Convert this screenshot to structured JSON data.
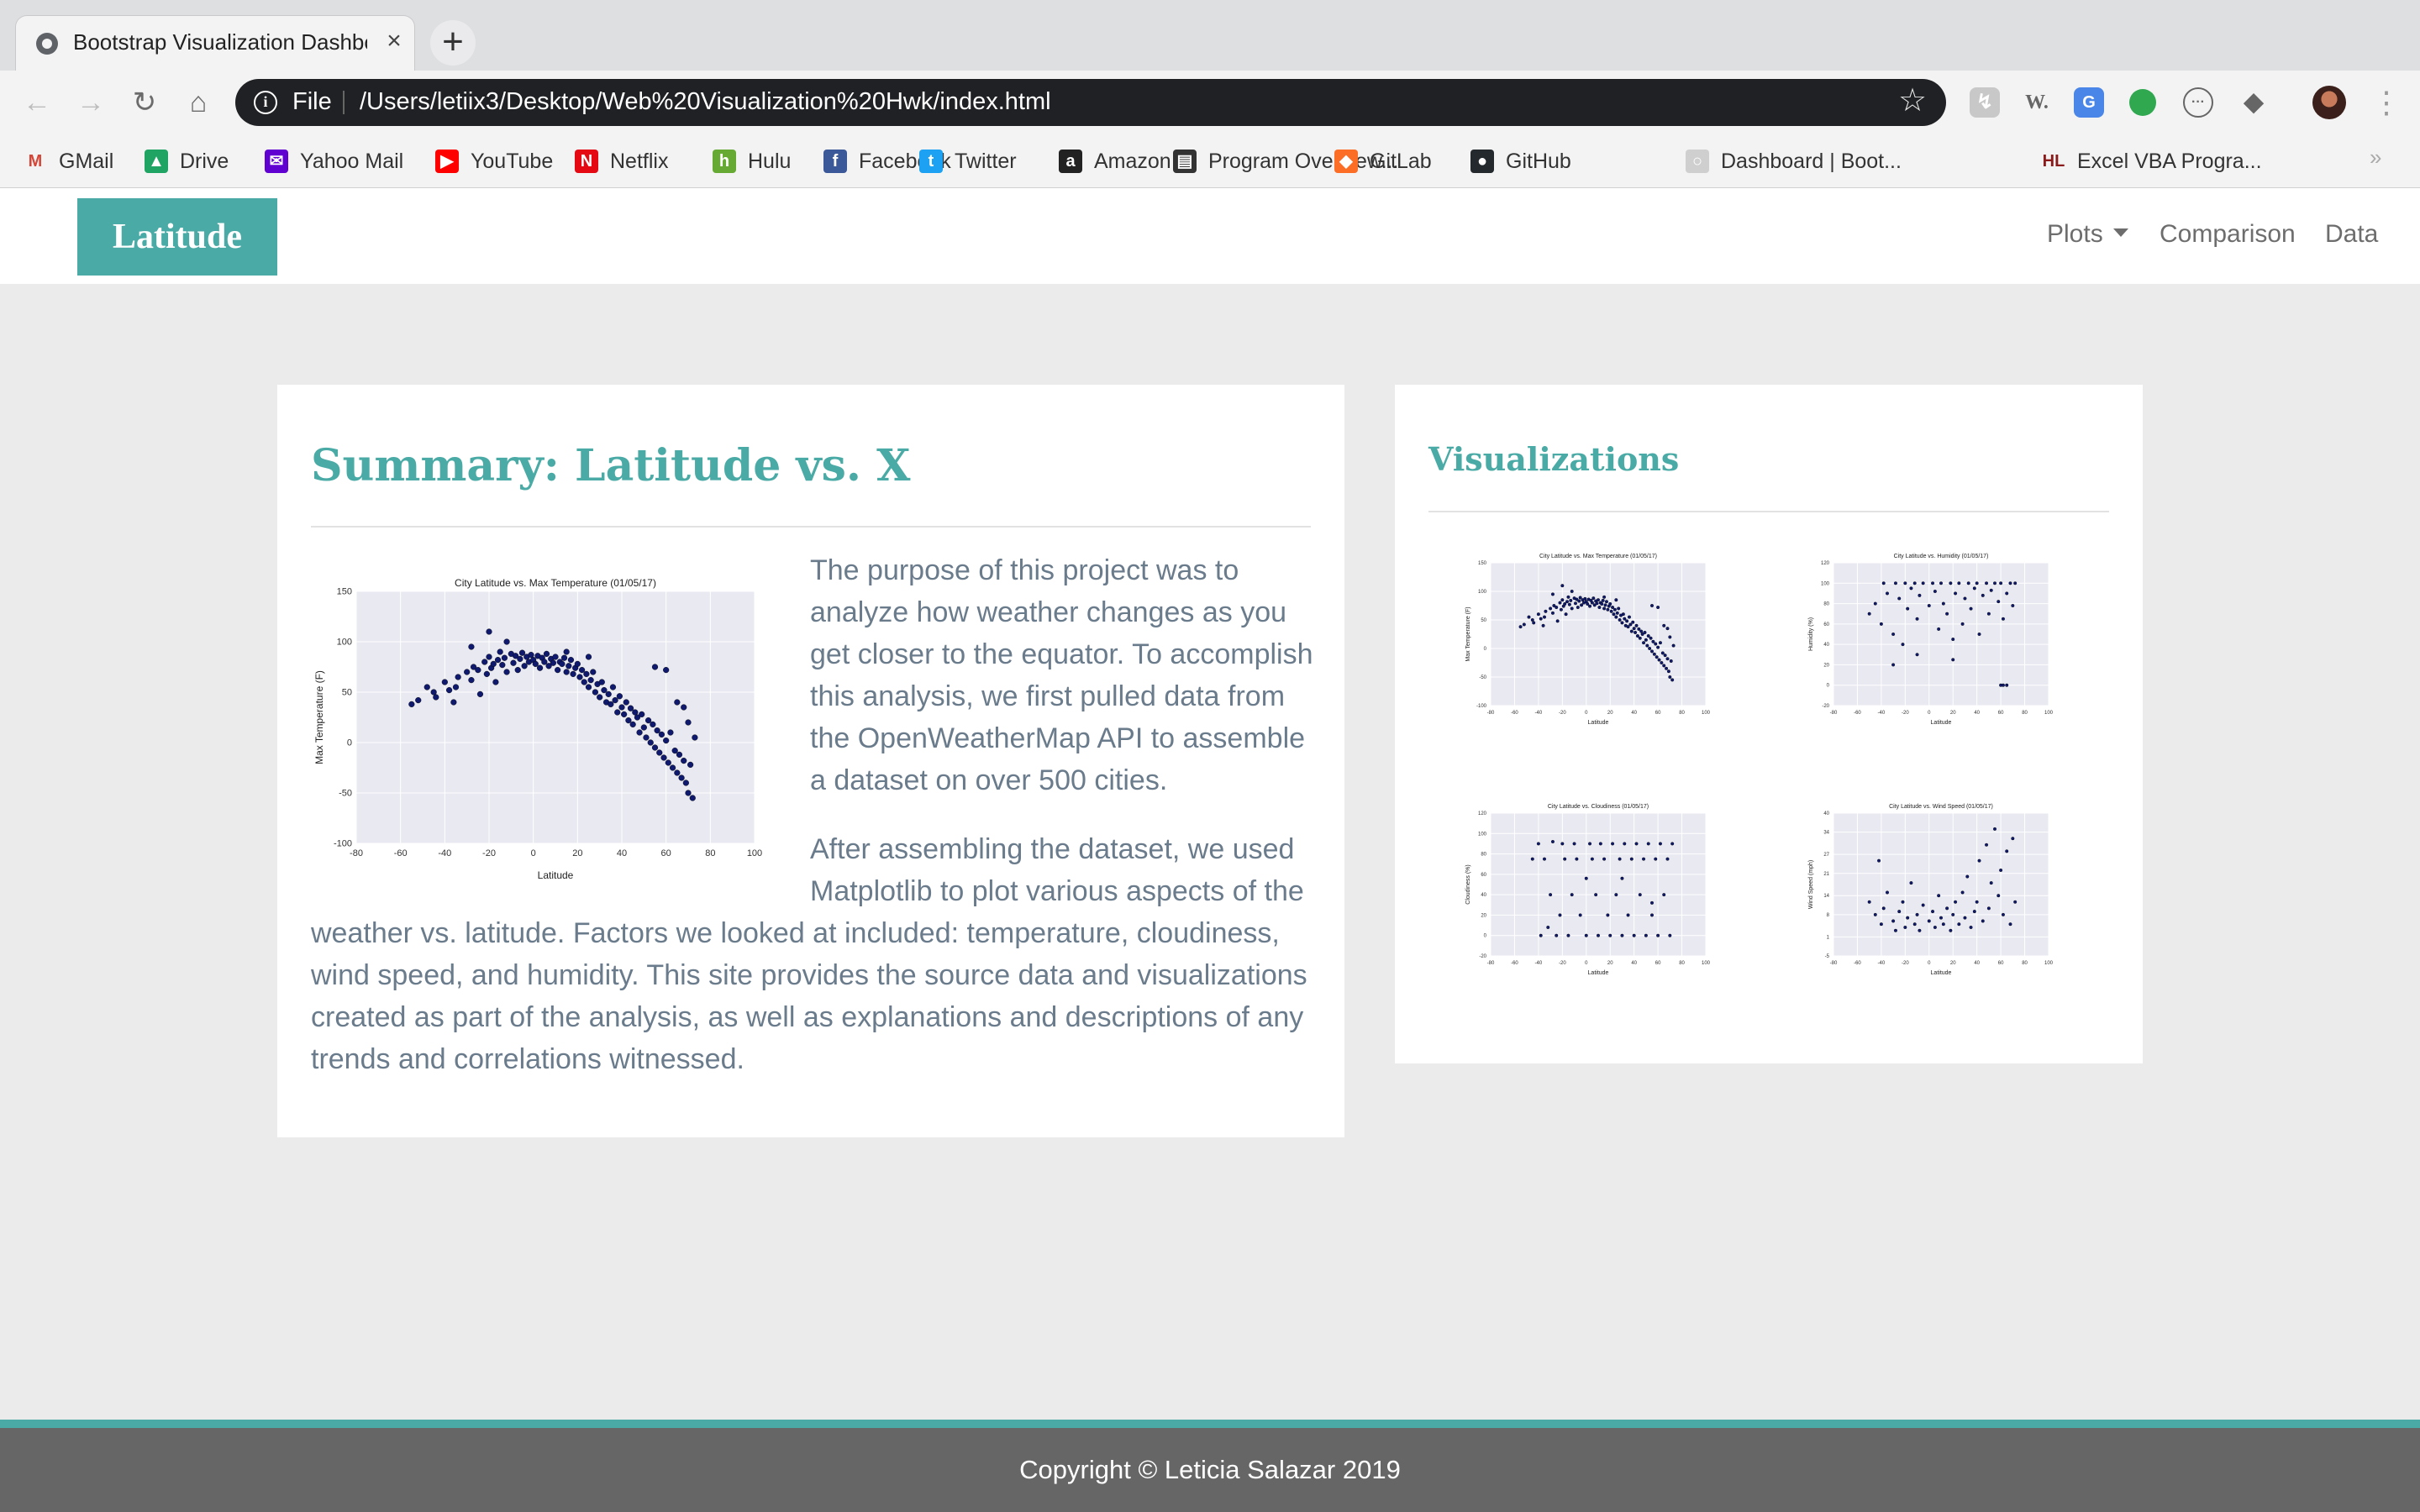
{
  "browser": {
    "tab": {
      "title": "Bootstrap Visualization Dashbo",
      "close_glyph": "×",
      "favicon": "globe-icon"
    },
    "new_tab_glyph": "+",
    "nav": {
      "back": "←",
      "forward": "→",
      "reload": "↻",
      "home": "⌂"
    },
    "address": {
      "scheme": "File",
      "url": "/Users/letiix3/Desktop/Web%20Visualization%20Hwk/index.html",
      "star": "☆"
    },
    "menu_glyph": "⋮",
    "bookmarks": [
      {
        "label": "GMail",
        "icon": "gmail-icon",
        "glyph": "M",
        "color": "#d44638"
      },
      {
        "label": "Drive",
        "icon": "drive-icon",
        "glyph": "▲",
        "color": "#1fa463"
      },
      {
        "label": "Yahoo Mail",
        "icon": "yahoo-mail-icon",
        "glyph": "✉",
        "color": "#6001d2"
      },
      {
        "label": "YouTube",
        "icon": "youtube-icon",
        "glyph": "▶",
        "color": "#ff0000"
      },
      {
        "label": "Netflix",
        "icon": "netflix-icon",
        "glyph": "N",
        "color": "#e50914"
      },
      {
        "label": "Hulu",
        "icon": "hulu-icon",
        "glyph": "h",
        "color": "#66aa33"
      },
      {
        "label": "Facebook",
        "icon": "facebook-icon",
        "glyph": "f",
        "color": "#3b5998"
      },
      {
        "label": "Twitter",
        "icon": "twitter-icon",
        "glyph": "t",
        "color": "#1da1f2"
      },
      {
        "label": "Amazon",
        "icon": "amazon-icon",
        "glyph": "a",
        "color": "#222222"
      },
      {
        "label": "Program Overview...",
        "icon": "book-icon",
        "glyph": "▤",
        "color": "#333333"
      },
      {
        "label": "GitLab",
        "icon": "gitlab-icon",
        "glyph": "◆",
        "color": "#fc6d26"
      },
      {
        "label": "GitHub",
        "icon": "github-icon",
        "glyph": "●",
        "color": "#24292e"
      },
      {
        "label": "Dashboard | Boot...",
        "icon": "globe-icon",
        "glyph": "○",
        "color": "#cfcfcf"
      },
      {
        "label": "Excel VBA Progra...",
        "icon": "excel-vba-icon",
        "glyph": "HL",
        "color": "#8b1a1a"
      }
    ],
    "bookmarks_overflow": "»"
  },
  "page": {
    "brand": "Latitude",
    "nav": {
      "plots": "Plots",
      "comparison": "Comparison",
      "data": "Data"
    },
    "summary": {
      "title": "Summary: Latitude vs. X",
      "paragraph1": "The purpose of this project was to analyze how weather changes as you get closer to the equator. To accomplish this analysis, we first pulled data from the OpenWeatherMap API to assemble a dataset on over 500 cities.",
      "paragraph2_line1": "After assembling the dataset, we used",
      "paragraph2_line2": "Matplotlib to plot various aspects of the",
      "paragraph2_rest": "weather vs. latitude. Factors we looked at included: temperature, cloudiness, wind speed, and humidity. This site provides the source data and visualizations created as part of the analysis, as well as explanations and descriptions of any trends and correlations witnessed."
    },
    "visualizations_title": "Visualizations",
    "footer": "Copyright © Leticia Salazar 2019",
    "accent_color": "#4aaaa5",
    "marker_color": "#0f1a6e"
  },
  "chart_data": [
    {
      "type": "scatter",
      "id": "temperature",
      "title": "City Latitude vs. Max Temperature (01/05/17)",
      "xlabel": "Latitude",
      "ylabel": "Max Temperature (F)",
      "xlim": [
        -80,
        100
      ],
      "ylim": [
        -100,
        150
      ],
      "xticks": [
        -80,
        -60,
        -40,
        -20,
        0,
        20,
        40,
        60,
        80,
        100
      ],
      "yticks": [
        -100,
        -50,
        0,
        50,
        100,
        150
      ],
      "grid": true,
      "trend": "peak near latitude 0 to 20, falling steeply poleward",
      "points": [
        [
          -55,
          38
        ],
        [
          -52,
          42
        ],
        [
          -45,
          50
        ],
        [
          -44,
          45
        ],
        [
          -40,
          60
        ],
        [
          -38,
          52
        ],
        [
          -35,
          55
        ],
        [
          -34,
          65
        ],
        [
          -30,
          70
        ],
        [
          -28,
          62
        ],
        [
          -27,
          75
        ],
        [
          -25,
          72
        ],
        [
          -24,
          48
        ],
        [
          -22,
          80
        ],
        [
          -21,
          68
        ],
        [
          -20,
          85
        ],
        [
          -19,
          74
        ],
        [
          -18,
          78
        ],
        [
          -17,
          60
        ],
        [
          -16,
          82
        ],
        [
          -15,
          90
        ],
        [
          -14,
          77
        ],
        [
          -13,
          84
        ],
        [
          -12,
          70
        ],
        [
          -10,
          88
        ],
        [
          -9,
          79
        ],
        [
          -8,
          86
        ],
        [
          -7,
          72
        ],
        [
          -6,
          83
        ],
        [
          -5,
          89
        ],
        [
          -4,
          76
        ],
        [
          -3,
          85
        ],
        [
          -2,
          80
        ],
        [
          -1,
          87
        ],
        [
          0,
          82
        ],
        [
          1,
          78
        ],
        [
          2,
          86
        ],
        [
          3,
          74
        ],
        [
          4,
          84
        ],
        [
          5,
          80
        ],
        [
          6,
          88
        ],
        [
          7,
          76
        ],
        [
          8,
          83
        ],
        [
          9,
          79
        ],
        [
          10,
          85
        ],
        [
          11,
          72
        ],
        [
          12,
          80
        ],
        [
          13,
          78
        ],
        [
          14,
          84
        ],
        [
          15,
          70
        ],
        [
          16,
          76
        ],
        [
          17,
          82
        ],
        [
          18,
          68
        ],
        [
          19,
          74
        ],
        [
          20,
          78
        ],
        [
          21,
          65
        ],
        [
          22,
          72
        ],
        [
          23,
          60
        ],
        [
          24,
          68
        ],
        [
          25,
          55
        ],
        [
          26,
          62
        ],
        [
          27,
          70
        ],
        [
          28,
          50
        ],
        [
          29,
          58
        ],
        [
          30,
          45
        ],
        [
          31,
          60
        ],
        [
          32,
          52
        ],
        [
          33,
          40
        ],
        [
          34,
          48
        ],
        [
          35,
          38
        ],
        [
          36,
          55
        ],
        [
          37,
          42
        ],
        [
          38,
          30
        ],
        [
          39,
          46
        ],
        [
          40,
          35
        ],
        [
          41,
          28
        ],
        [
          42,
          40
        ],
        [
          43,
          22
        ],
        [
          44,
          34
        ],
        [
          45,
          18
        ],
        [
          46,
          30
        ],
        [
          47,
          25
        ],
        [
          48,
          10
        ],
        [
          49,
          28
        ],
        [
          50,
          15
        ],
        [
          51,
          5
        ],
        [
          52,
          22
        ],
        [
          53,
          0
        ],
        [
          54,
          18
        ],
        [
          55,
          -5
        ],
        [
          56,
          12
        ],
        [
          57,
          -10
        ],
        [
          58,
          8
        ],
        [
          59,
          -15
        ],
        [
          60,
          2
        ],
        [
          61,
          -20
        ],
        [
          62,
          10
        ],
        [
          63,
          -25
        ],
        [
          64,
          -8
        ],
        [
          65,
          -30
        ],
        [
          66,
          -12
        ],
        [
          67,
          -35
        ],
        [
          68,
          -18
        ],
        [
          69,
          -40
        ],
        [
          70,
          -50
        ],
        [
          71,
          -22
        ],
        [
          72,
          -55
        ],
        [
          68,
          35
        ],
        [
          70,
          20
        ],
        [
          73,
          5
        ],
        [
          65,
          40
        ],
        [
          -20,
          110
        ],
        [
          -28,
          95
        ],
        [
          -12,
          100
        ],
        [
          15,
          90
        ],
        [
          25,
          85
        ],
        [
          55,
          75
        ],
        [
          60,
          72
        ],
        [
          -36,
          40
        ],
        [
          -48,
          55
        ]
      ]
    },
    {
      "type": "scatter",
      "id": "humidity",
      "title": "City Latitude vs. Humidity (01/05/17)",
      "xlabel": "Latitude",
      "ylabel": "Humidity (%)",
      "xlim": [
        -80,
        100
      ],
      "ylim": [
        -20,
        120
      ],
      "grid": true,
      "points": [
        [
          -50,
          70
        ],
        [
          -45,
          80
        ],
        [
          -40,
          60
        ],
        [
          -38,
          100
        ],
        [
          -35,
          90
        ],
        [
          -30,
          50
        ],
        [
          -28,
          100
        ],
        [
          -25,
          85
        ],
        [
          -22,
          40
        ],
        [
          -20,
          100
        ],
        [
          -18,
          75
        ],
        [
          -15,
          95
        ],
        [
          -12,
          100
        ],
        [
          -10,
          65
        ],
        [
          -8,
          88
        ],
        [
          -5,
          100
        ],
        [
          0,
          78
        ],
        [
          3,
          100
        ],
        [
          5,
          92
        ],
        [
          8,
          55
        ],
        [
          10,
          100
        ],
        [
          12,
          80
        ],
        [
          15,
          70
        ],
        [
          18,
          100
        ],
        [
          20,
          45
        ],
        [
          22,
          90
        ],
        [
          25,
          100
        ],
        [
          28,
          60
        ],
        [
          30,
          85
        ],
        [
          33,
          100
        ],
        [
          35,
          75
        ],
        [
          38,
          95
        ],
        [
          40,
          100
        ],
        [
          42,
          50
        ],
        [
          45,
          88
        ],
        [
          48,
          100
        ],
        [
          50,
          70
        ],
        [
          52,
          93
        ],
        [
          55,
          100
        ],
        [
          58,
          82
        ],
        [
          60,
          100
        ],
        [
          62,
          65
        ],
        [
          65,
          90
        ],
        [
          68,
          100
        ],
        [
          70,
          78
        ],
        [
          72,
          100
        ],
        [
          60,
          0
        ],
        [
          62,
          0
        ],
        [
          65,
          0
        ],
        [
          -30,
          20
        ],
        [
          -10,
          30
        ],
        [
          20,
          25
        ]
      ]
    },
    {
      "type": "scatter",
      "id": "cloudiness",
      "title": "City Latitude vs. Cloudiness (01/05/17)",
      "xlabel": "Latitude",
      "ylabel": "Cloudiness (%)",
      "xlim": [
        -80,
        100
      ],
      "ylim": [
        -20,
        120
      ],
      "grid": true,
      "points": [
        [
          -45,
          75
        ],
        [
          -40,
          90
        ],
        [
          -38,
          0
        ],
        [
          -35,
          75
        ],
        [
          -30,
          40
        ],
        [
          -28,
          92
        ],
        [
          -25,
          0
        ],
        [
          -22,
          20
        ],
        [
          -20,
          90
        ],
        [
          -18,
          75
        ],
        [
          -15,
          0
        ],
        [
          -12,
          40
        ],
        [
          -10,
          90
        ],
        [
          -8,
          75
        ],
        [
          -5,
          20
        ],
        [
          0,
          0
        ],
        [
          3,
          90
        ],
        [
          5,
          75
        ],
        [
          8,
          40
        ],
        [
          10,
          0
        ],
        [
          12,
          90
        ],
        [
          15,
          75
        ],
        [
          18,
          20
        ],
        [
          20,
          0
        ],
        [
          22,
          90
        ],
        [
          25,
          40
        ],
        [
          28,
          75
        ],
        [
          30,
          0
        ],
        [
          32,
          90
        ],
        [
          35,
          20
        ],
        [
          38,
          75
        ],
        [
          40,
          0
        ],
        [
          42,
          90
        ],
        [
          45,
          40
        ],
        [
          48,
          75
        ],
        [
          50,
          0
        ],
        [
          52,
          90
        ],
        [
          55,
          20
        ],
        [
          58,
          75
        ],
        [
          60,
          0
        ],
        [
          62,
          90
        ],
        [
          65,
          40
        ],
        [
          68,
          75
        ],
        [
          70,
          0
        ],
        [
          72,
          90
        ],
        [
          -32,
          8
        ],
        [
          0,
          56
        ],
        [
          30,
          56
        ],
        [
          55,
          32
        ]
      ]
    },
    {
      "type": "scatter",
      "id": "wind",
      "title": "City Latitude vs. Wind Speed (01/05/17)",
      "xlabel": "Latitude",
      "ylabel": "Wind Speed (mph)",
      "xlim": [
        -80,
        100
      ],
      "ylim": [
        -5,
        40
      ],
      "grid": true,
      "points": [
        [
          -50,
          12
        ],
        [
          -45,
          8
        ],
        [
          -42,
          25
        ],
        [
          -40,
          5
        ],
        [
          -38,
          10
        ],
        [
          -35,
          15
        ],
        [
          -30,
          6
        ],
        [
          -28,
          3
        ],
        [
          -25,
          9
        ],
        [
          -22,
          12
        ],
        [
          -20,
          4
        ],
        [
          -18,
          7
        ],
        [
          -15,
          18
        ],
        [
          -12,
          5
        ],
        [
          -10,
          8
        ],
        [
          -8,
          3
        ],
        [
          -5,
          11
        ],
        [
          0,
          6
        ],
        [
          3,
          9
        ],
        [
          5,
          4
        ],
        [
          8,
          14
        ],
        [
          10,
          7
        ],
        [
          12,
          5
        ],
        [
          15,
          10
        ],
        [
          18,
          3
        ],
        [
          20,
          8
        ],
        [
          22,
          12
        ],
        [
          25,
          5
        ],
        [
          28,
          15
        ],
        [
          30,
          7
        ],
        [
          32,
          20
        ],
        [
          35,
          4
        ],
        [
          38,
          9
        ],
        [
          40,
          12
        ],
        [
          42,
          25
        ],
        [
          45,
          6
        ],
        [
          48,
          30
        ],
        [
          50,
          10
        ],
        [
          52,
          18
        ],
        [
          55,
          35
        ],
        [
          58,
          14
        ],
        [
          60,
          22
        ],
        [
          62,
          8
        ],
        [
          65,
          28
        ],
        [
          68,
          5
        ],
        [
          70,
          32
        ],
        [
          72,
          12
        ]
      ]
    }
  ]
}
